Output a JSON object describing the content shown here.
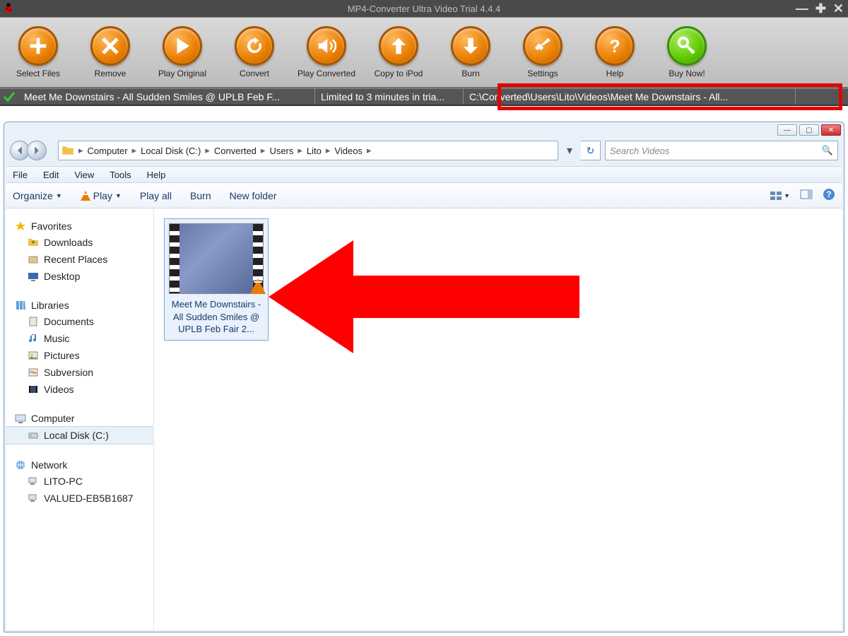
{
  "converter": {
    "title": "MP4-Converter Ultra Video Trial 4.4.4",
    "toolbar": [
      {
        "label": "Select Files",
        "icon": "plus"
      },
      {
        "label": "Remove",
        "icon": "x"
      },
      {
        "label": "Play Original",
        "icon": "play"
      },
      {
        "label": "Convert",
        "icon": "refresh"
      },
      {
        "label": "Play Converted",
        "icon": "speaker"
      },
      {
        "label": "Copy to iPod",
        "icon": "up"
      },
      {
        "label": "Burn",
        "icon": "down"
      },
      {
        "label": "Settings",
        "icon": "tools"
      },
      {
        "label": "Help",
        "icon": "question"
      },
      {
        "label": "Buy Now!",
        "icon": "key",
        "green": true
      }
    ],
    "status": {
      "file": "Meet Me Downstairs - All Sudden Smiles @ UPLB Feb F...",
      "limit": "Limited to 3 minutes in tria...",
      "path": "C:\\Converted\\Users\\Lito\\Videos\\Meet Me Downstairs - All..."
    }
  },
  "explorer": {
    "breadcrumb": [
      "Computer",
      "Local Disk (C:)",
      "Converted",
      "Users",
      "Lito",
      "Videos"
    ],
    "search_placeholder": "Search Videos",
    "menu": [
      "File",
      "Edit",
      "View",
      "Tools",
      "Help"
    ],
    "commands": {
      "organize": "Organize",
      "play": "Play",
      "play_all": "Play all",
      "burn": "Burn",
      "new_folder": "New folder"
    },
    "sidebar": {
      "favorites": {
        "label": "Favorites",
        "items": [
          "Downloads",
          "Recent Places",
          "Desktop"
        ]
      },
      "libraries": {
        "label": "Libraries",
        "items": [
          "Documents",
          "Music",
          "Pictures",
          "Subversion",
          "Videos"
        ]
      },
      "computer": {
        "label": "Computer",
        "items": [
          "Local Disk (C:)"
        ]
      },
      "network": {
        "label": "Network",
        "items": [
          "LITO-PC",
          "VALUED-EB5B1687"
        ]
      }
    },
    "file": {
      "name": "Meet Me Downstairs - All Sudden Smiles @ UPLB Feb Fair 2..."
    }
  }
}
